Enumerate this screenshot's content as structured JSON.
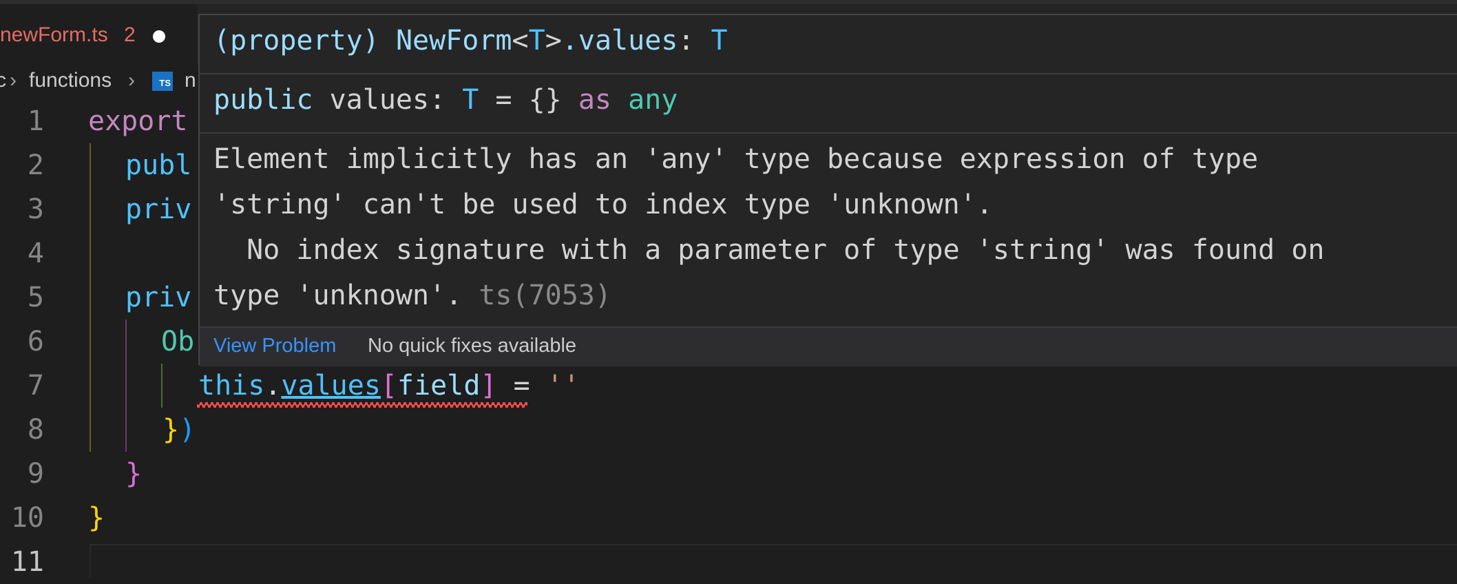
{
  "tab": {
    "filename": "newForm.ts",
    "problem_count": "2"
  },
  "breadcrumb": {
    "part1": "c",
    "part2": "functions",
    "ts_icon": "TS",
    "part3": "n"
  },
  "code": {
    "line_numbers": [
      "1",
      "2",
      "3",
      "4",
      "5",
      "6",
      "7",
      "8",
      "9",
      "10",
      "11"
    ],
    "line1": "export",
    "line2": "publ",
    "line3": "priv",
    "line5": "priv",
    "line6": "Ob",
    "line7": {
      "this": "this",
      "dot": ".",
      "values": "values",
      "open": "[",
      "field": "field",
      "close": "]",
      "eq": " = ",
      "str": "''"
    },
    "line8": {
      "brace": "}",
      "paren": ")"
    },
    "line9": "}",
    "line10": "}"
  },
  "hover": {
    "sig1": {
      "open": "(",
      "prop": "property",
      "close": ")",
      "cls": "NewForm",
      "lt": "<",
      "t": "T",
      "gt": ">",
      "member": ".values",
      "colon": ": ",
      "type": "T"
    },
    "sig2": {
      "pub": "public",
      "name": " values: ",
      "t": "T",
      "eq": " = {} ",
      "as": "as",
      "sp": " ",
      "any": "any"
    },
    "message": [
      "Element implicitly has an 'any' type because expression of type",
      "'string' can't be used to index type 'unknown'.",
      "  No index signature with a parameter of type 'string' was found on",
      "type 'unknown'."
    ],
    "code": " ts(7053)",
    "view_problem": "View Problem",
    "no_fixes": "No quick fixes available"
  },
  "colors": {
    "error": "#f14c4c",
    "link": "#3794ff",
    "keyword": "#c586c0"
  }
}
